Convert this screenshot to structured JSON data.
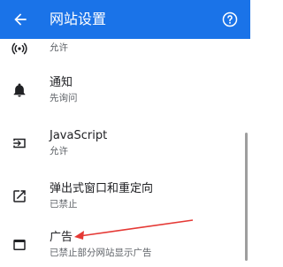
{
  "header": {
    "title": "网站设置",
    "back_icon": "arrow-back-icon",
    "help_icon": "help-icon",
    "bar_color": "#1a73e8"
  },
  "settings": [
    {
      "icon": "sensors-icon",
      "label": "",
      "sub": "允许"
    },
    {
      "icon": "notification-bell-icon",
      "label": "通知",
      "sub": "先询问"
    },
    {
      "icon": "javascript-icon",
      "label": "JavaScript",
      "sub": "允许"
    },
    {
      "icon": "open-in-new-icon",
      "label": "弹出式窗口和重定向",
      "sub": "已禁止"
    },
    {
      "icon": "web-window-icon",
      "label": "广告",
      "sub": "已禁止部分网站显示广告"
    }
  ],
  "annotation": {
    "color": "#e53935"
  }
}
